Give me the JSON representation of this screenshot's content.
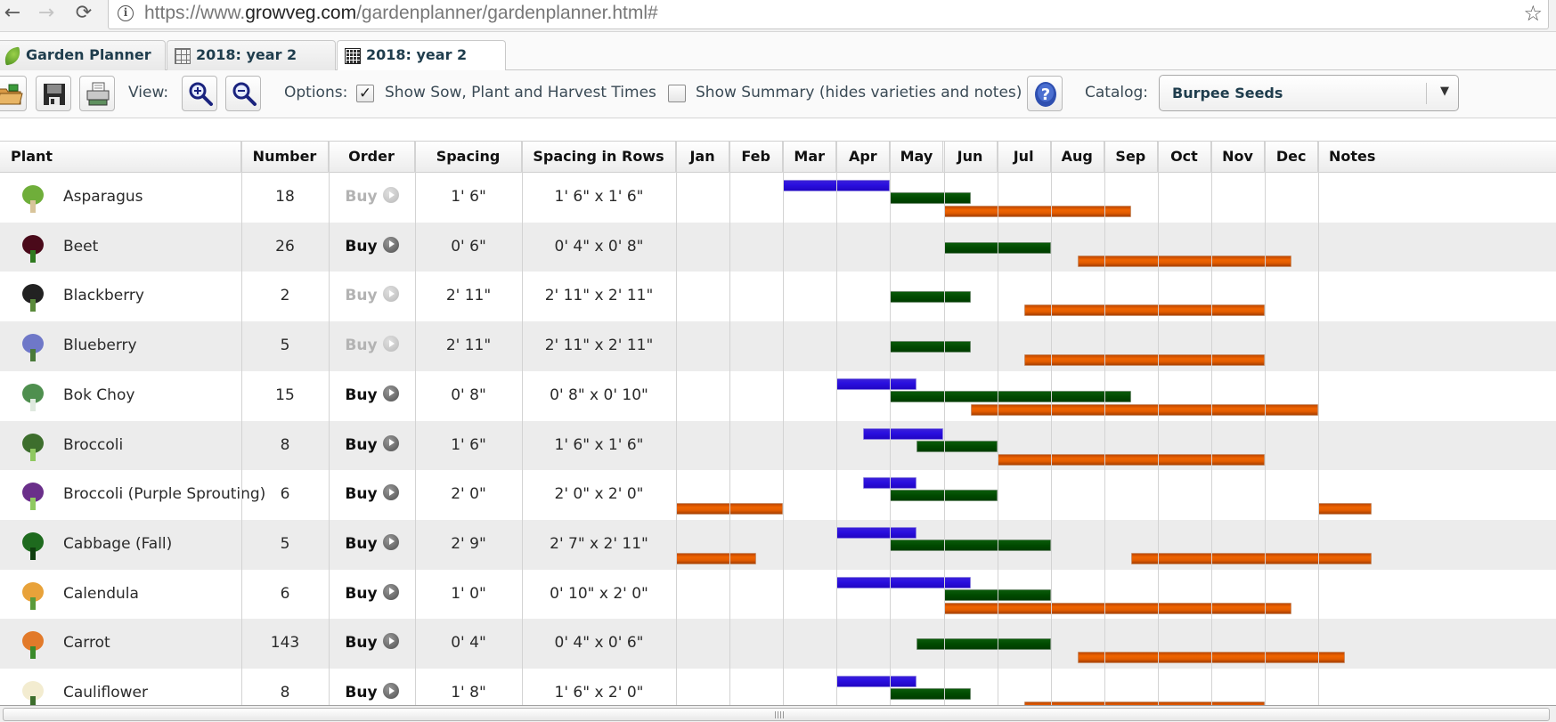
{
  "browser": {
    "url_prefix": "https://www.",
    "url_domain": "growveg.com",
    "url_path": "/gardenplanner/gardenplanner.html#",
    "back_icon": "←",
    "forward_icon": "→",
    "reload_icon": "⟳",
    "info_icon": "i",
    "star_icon": "☆"
  },
  "tabs": [
    {
      "label": "Garden Planner",
      "icon": "leaf-icon",
      "active": false
    },
    {
      "label": "2018: year 2",
      "icon": "grid-icon",
      "active": false
    },
    {
      "label": "2018: year 2",
      "icon": "table-icon",
      "active": true
    }
  ],
  "toolbar": {
    "view_label": "View:",
    "options_label": "Options:",
    "show_times_label": "Show Sow, Plant and Harvest Times",
    "show_times_checked": true,
    "show_summary_label": "Show Summary (hides varieties and notes)",
    "show_summary_checked": false,
    "checkmark": "✓",
    "catalog_label": "Catalog:",
    "catalog_value": "Burpee Seeds",
    "dropdown_arrow": "▼"
  },
  "table": {
    "headers": {
      "plant": "Plant",
      "number": "Number",
      "order": "Order",
      "spacing": "Spacing",
      "spacing_rows": "Spacing in Rows",
      "months": [
        "Jan",
        "Feb",
        "Mar",
        "Apr",
        "May",
        "Jun",
        "Jul",
        "Aug",
        "Sep",
        "Oct",
        "Nov",
        "Dec"
      ],
      "notes": "Notes"
    },
    "buy_label": "Buy",
    "legend_colors": {
      "sow": "#2a10e0",
      "plant": "#004a00",
      "harvest": "#ef6400"
    },
    "rows": [
      {
        "plant": "Asparagus",
        "number": "18",
        "buy_enabled": false,
        "spacing": "1' 6\"",
        "spacing_rows": "1' 6\" x 1' 6\"",
        "sow": [
          [
            2,
            4
          ]
        ],
        "plant_out": [
          [
            4,
            5.5
          ]
        ],
        "harvest": [
          [
            5,
            8.5
          ]
        ]
      },
      {
        "plant": "Beet",
        "number": "26",
        "buy_enabled": true,
        "spacing": "0' 6\"",
        "spacing_rows": "0' 4\" x 0' 8\"",
        "sow": [],
        "plant_out": [
          [
            5,
            7
          ]
        ],
        "harvest": [
          [
            7.5,
            11.5
          ]
        ]
      },
      {
        "plant": "Blackberry",
        "number": "2",
        "buy_enabled": false,
        "spacing": "2' 11\"",
        "spacing_rows": "2' 11\" x 2' 11\"",
        "sow": [],
        "plant_out": [
          [
            4,
            5.5
          ]
        ],
        "harvest": [
          [
            6.5,
            11
          ]
        ]
      },
      {
        "plant": "Blueberry",
        "number": "5",
        "buy_enabled": false,
        "spacing": "2' 11\"",
        "spacing_rows": "2' 11\" x 2' 11\"",
        "sow": [],
        "plant_out": [
          [
            4,
            5.5
          ]
        ],
        "harvest": [
          [
            6.5,
            11
          ]
        ]
      },
      {
        "plant": "Bok Choy",
        "number": "15",
        "buy_enabled": true,
        "spacing": "0' 8\"",
        "spacing_rows": "0' 8\" x 0' 10\"",
        "sow": [
          [
            3,
            4.5
          ]
        ],
        "plant_out": [
          [
            4,
            8.5
          ]
        ],
        "harvest": [
          [
            5.5,
            12
          ]
        ]
      },
      {
        "plant": "Broccoli",
        "number": "8",
        "buy_enabled": true,
        "spacing": "1' 6\"",
        "spacing_rows": "1' 6\" x 1' 6\"",
        "sow": [
          [
            3.5,
            5
          ]
        ],
        "plant_out": [
          [
            4.5,
            6
          ]
        ],
        "harvest": [
          [
            6,
            11
          ]
        ]
      },
      {
        "plant": "Broccoli (Purple Sprouting)",
        "number": "6",
        "buy_enabled": true,
        "spacing": "2' 0\"",
        "spacing_rows": "2' 0\" x 2' 0\"",
        "sow": [
          [
            3.5,
            4.5
          ]
        ],
        "plant_out": [
          [
            4,
            6
          ]
        ],
        "harvest": [
          [
            0,
            2
          ],
          [
            12,
            13
          ]
        ]
      },
      {
        "plant": "Cabbage (Fall)",
        "number": "5",
        "buy_enabled": true,
        "spacing": "2' 9\"",
        "spacing_rows": "2' 7\" x 2' 11\"",
        "sow": [
          [
            3,
            4.5
          ]
        ],
        "plant_out": [
          [
            4,
            7
          ]
        ],
        "harvest": [
          [
            0,
            1.5
          ],
          [
            8.5,
            13
          ]
        ]
      },
      {
        "plant": "Calendula",
        "number": "6",
        "buy_enabled": true,
        "spacing": "1' 0\"",
        "spacing_rows": "0' 10\" x 2' 0\"",
        "sow": [
          [
            3,
            5.5
          ]
        ],
        "plant_out": [
          [
            5,
            7
          ]
        ],
        "harvest": [
          [
            5,
            11.5
          ]
        ]
      },
      {
        "plant": "Carrot",
        "number": "143",
        "buy_enabled": true,
        "spacing": "0' 4\"",
        "spacing_rows": "0' 4\" x 0' 6\"",
        "sow": [],
        "plant_out": [
          [
            4.5,
            7
          ]
        ],
        "harvest": [
          [
            7.5,
            12.5
          ]
        ]
      },
      {
        "plant": "Cauliflower",
        "number": "8",
        "buy_enabled": true,
        "spacing": "1' 8\"",
        "spacing_rows": "1' 6\" x 2' 0\"",
        "sow": [
          [
            3,
            4.5
          ]
        ],
        "plant_out": [
          [
            4,
            5.5
          ]
        ],
        "harvest": [
          [
            6.5,
            11
          ]
        ]
      }
    ]
  }
}
